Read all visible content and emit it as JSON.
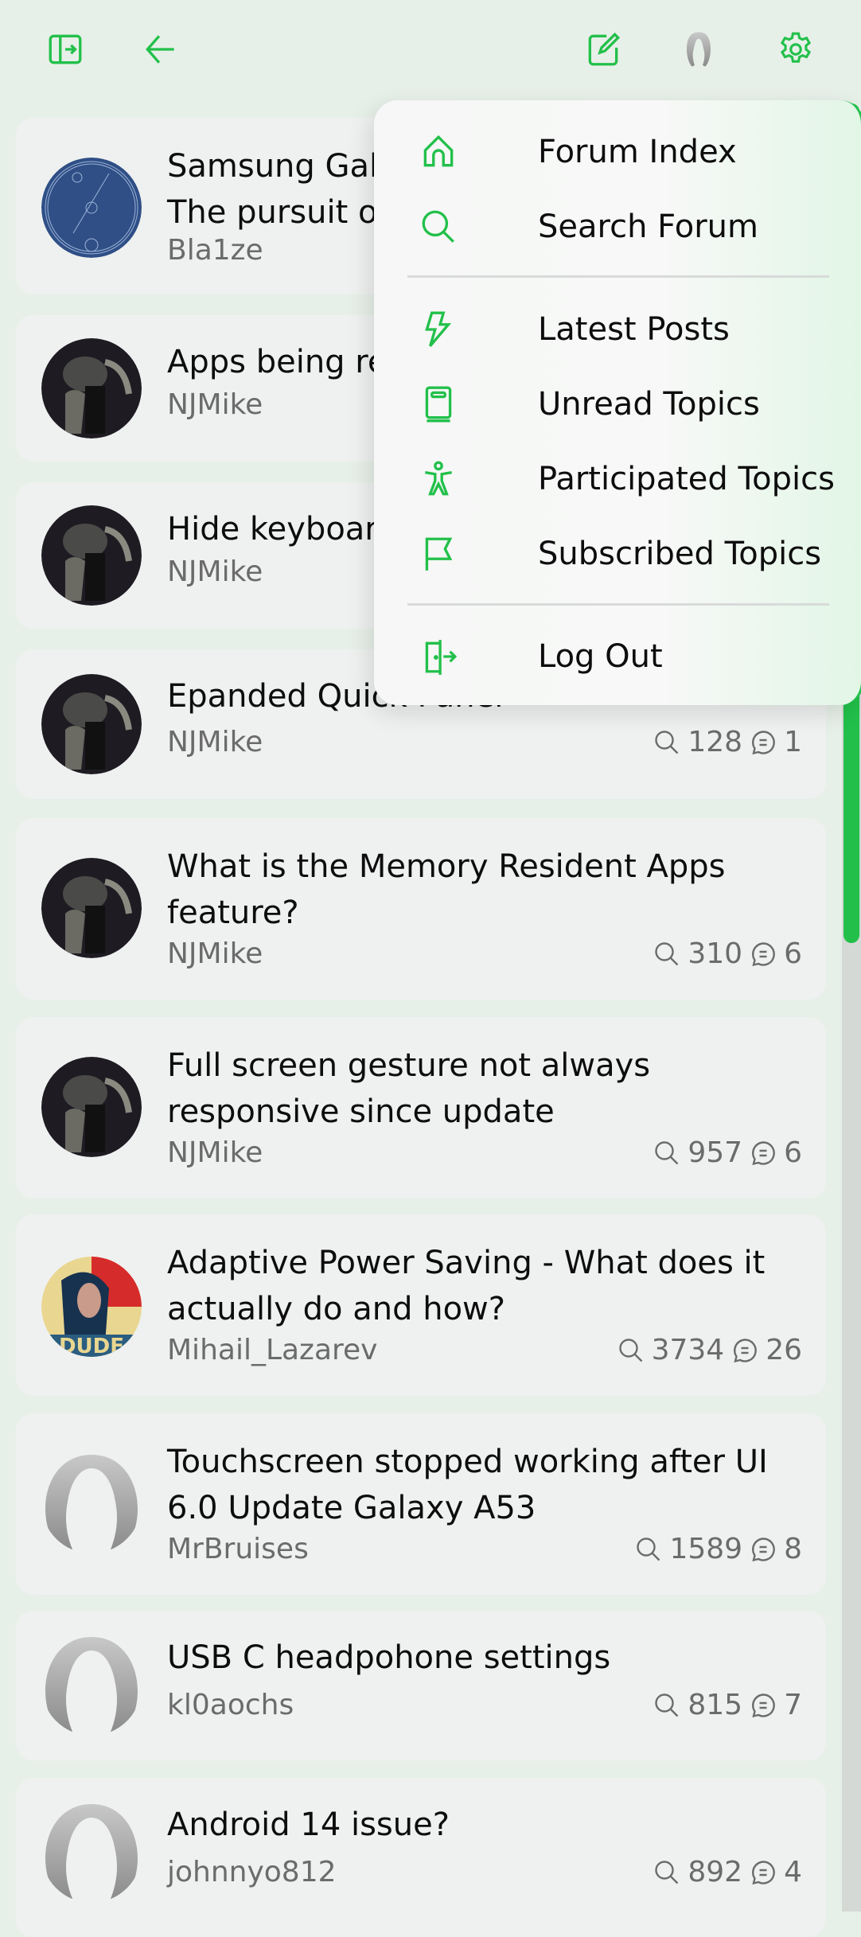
{
  "colors": {
    "accent": "#22c04a",
    "background": "#e7f0e8",
    "card": "#eff1f0",
    "muted_text": "#6b6b6b"
  },
  "topbar": {
    "icons": [
      "sidebar-toggle-icon",
      "back-arrow-icon",
      "compose-icon",
      "user-avatar-icon",
      "settings-gear-icon"
    ]
  },
  "menu": {
    "items": [
      {
        "label": "Forum Index",
        "icon": "home-icon"
      },
      {
        "label": "Search Forum",
        "icon": "search-icon"
      },
      {
        "label": "Latest Posts",
        "icon": "lightning-icon"
      },
      {
        "label": "Unread Topics",
        "icon": "book-icon"
      },
      {
        "label": "Participated Topics",
        "icon": "person-icon"
      },
      {
        "label": "Subscribed Topics",
        "icon": "flag-icon"
      },
      {
        "label": "Log Out",
        "icon": "logout-door-icon"
      }
    ]
  },
  "topics": [
    {
      "title": "Samsung Gal\nThe pursuit o",
      "author": "Bla1ze",
      "views": "",
      "replies": "",
      "avatar": "blue-emblem"
    },
    {
      "title": "Apps being re",
      "author": "NJMike",
      "views": "",
      "replies": "",
      "avatar": "dark-character"
    },
    {
      "title": "Hide keyboar",
      "author": "NJMike",
      "views": "",
      "replies": "",
      "avatar": "dark-character"
    },
    {
      "title": "Epanded Quick Panel",
      "author": "NJMike",
      "views": "128",
      "replies": "1",
      "avatar": "dark-character"
    },
    {
      "title": "What is the Memory Resident Apps feature?",
      "author": "NJMike",
      "views": "310",
      "replies": "6",
      "avatar": "dark-character"
    },
    {
      "title": "Full screen gesture not always responsive since update",
      "author": "NJMike",
      "views": "957",
      "replies": "6",
      "avatar": "dark-character"
    },
    {
      "title": "Adaptive Power Saving - What does it actually do and how?",
      "author": "Mihail_Lazarev",
      "views": "3734",
      "replies": "26",
      "avatar": "dude-poster"
    },
    {
      "title": "Touchscreen stopped working after UI 6.0 Update Galaxy A53",
      "author": "MrBruises",
      "views": "1589",
      "replies": "8",
      "avatar": "default-silhouette"
    },
    {
      "title": "USB C headpohone settings",
      "author": "kl0aochs",
      "views": "815",
      "replies": "7",
      "avatar": "default-silhouette"
    },
    {
      "title": "Android 14 issue?",
      "author": "johnnyo812",
      "views": "892",
      "replies": "4",
      "avatar": "default-silhouette"
    }
  ]
}
